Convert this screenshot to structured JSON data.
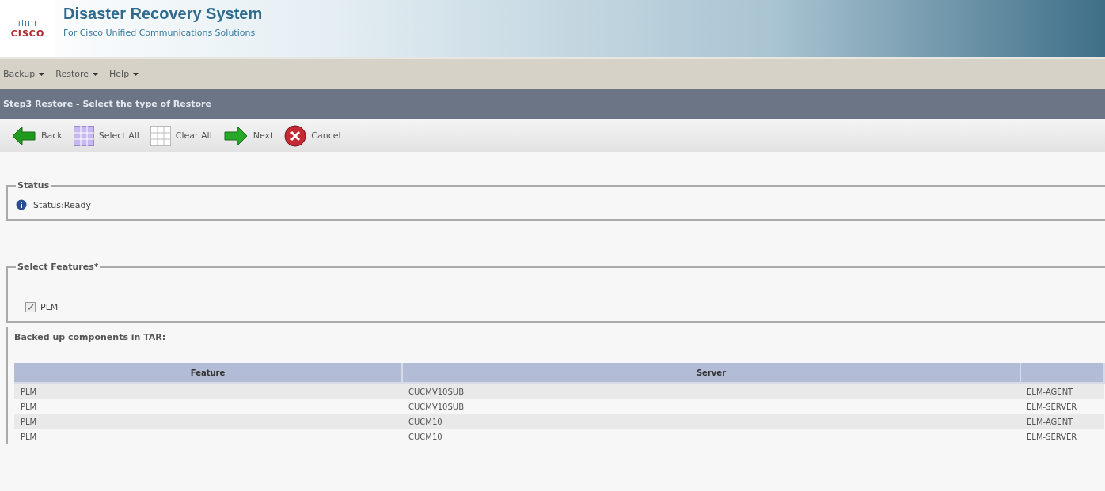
{
  "header": {
    "logo_top": "ılıılı",
    "logo": "CISCO",
    "title": "Disaster Recovery System",
    "subtitle": "For Cisco Unified Communications Solutions"
  },
  "menu": [
    {
      "label": "Backup"
    },
    {
      "label": "Restore"
    },
    {
      "label": "Help"
    }
  ],
  "page_title": "Step3 Restore - Select the type of Restore",
  "toolbar": [
    {
      "kind": "back",
      "label": "Back"
    },
    {
      "kind": "select",
      "label": "Select All"
    },
    {
      "kind": "clear",
      "label": "Clear All"
    },
    {
      "kind": "next",
      "label": "Next"
    },
    {
      "kind": "cancel",
      "label": "Cancel"
    }
  ],
  "status": {
    "legend": "Status",
    "text": "Status:Ready"
  },
  "features": {
    "legend": "Select Features*",
    "items": [
      {
        "label": "PLM",
        "checked": true
      }
    ]
  },
  "table": {
    "caption": "Backed up components in TAR:",
    "columns": [
      "Feature",
      "Server"
    ],
    "rows": [
      {
        "feature": "PLM",
        "server": "CUCMV10SUB",
        "column_3": "ELM-AGENT"
      },
      {
        "feature": "PLM",
        "server": "CUCMV10SUB",
        "column_3": "ELM-SERVER"
      },
      {
        "feature": "PLM",
        "server": "CUCM10",
        "column_3": "ELM-AGENT"
      },
      {
        "feature": "PLM",
        "server": "CUCM10",
        "column_3": "ELM-SERVER"
      }
    ]
  }
}
